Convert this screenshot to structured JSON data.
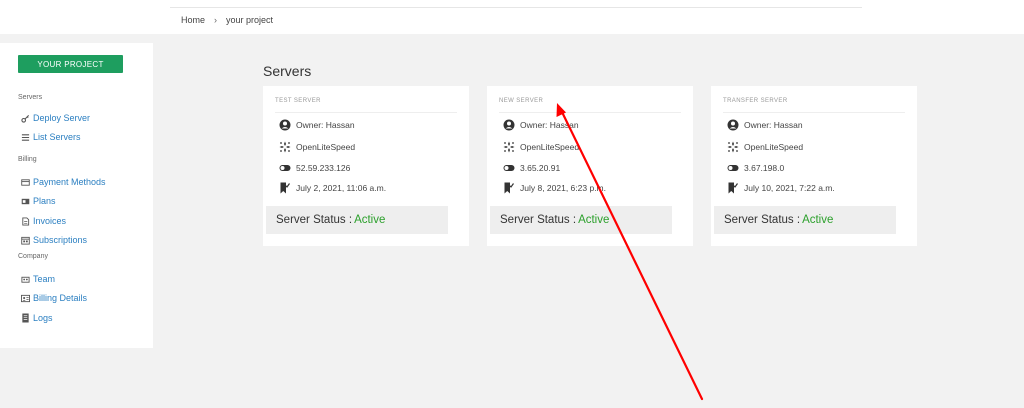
{
  "breadcrumb": {
    "home": "Home",
    "separator": "›",
    "current": "your project"
  },
  "sidebar": {
    "project_button": "YOUR PROJECT",
    "sections": [
      {
        "title": "Servers",
        "items": [
          {
            "label": "Deploy Server",
            "icon": "key-icon"
          },
          {
            "label": "List Servers",
            "icon": "list-icon"
          }
        ]
      },
      {
        "title": "Billing",
        "items": [
          {
            "label": "Payment Methods",
            "icon": "card-icon"
          },
          {
            "label": "Plans",
            "icon": "plan-icon"
          },
          {
            "label": "Invoices",
            "icon": "invoice-icon"
          },
          {
            "label": "Subscriptions",
            "icon": "calendar-icon"
          }
        ]
      },
      {
        "title": "Company",
        "items": [
          {
            "label": "Team",
            "icon": "team-icon"
          },
          {
            "label": "Billing Details",
            "icon": "id-card-icon"
          },
          {
            "label": "Logs",
            "icon": "log-icon"
          }
        ]
      }
    ]
  },
  "main": {
    "title": "Servers",
    "status_label": "Server Status :",
    "servers": [
      {
        "name": "TEST SERVER",
        "owner": "Owner: Hassan",
        "stack": "OpenLiteSpeed",
        "ip": "52.59.233.126",
        "created": "July 2, 2021, 11:06 a.m.",
        "status": "Active"
      },
      {
        "name": "NEW SERVER",
        "owner": "Owner: Hassan",
        "stack": "OpenLiteSpeed",
        "ip": "3.65.20.91",
        "created": "July 8, 2021, 6:23 p.m.",
        "status": "Active"
      },
      {
        "name": "TRANSFER SERVER",
        "owner": "Owner: Hassan",
        "stack": "OpenLiteSpeed",
        "ip": "3.67.198.0",
        "created": "July 10, 2021, 7:22 a.m.",
        "status": "Active"
      }
    ]
  },
  "colors": {
    "primary_button": "#1e9e5f",
    "link": "#2b7fc1",
    "status_active": "#2ca02c",
    "annotation_arrow": "#ff0000"
  }
}
